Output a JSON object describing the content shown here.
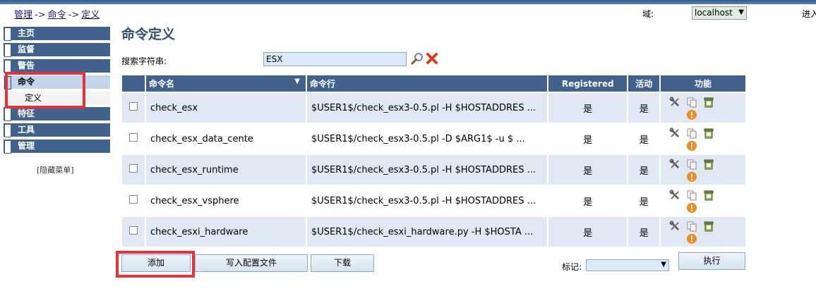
{
  "breadcrumb": {
    "item1": "管理",
    "item2": "命令",
    "item3": "定义",
    "sep": "->"
  },
  "domain": {
    "label": "域:",
    "value": "localhost"
  },
  "enter_label": "进入",
  "sidebar": {
    "items": [
      {
        "label": "主页"
      },
      {
        "label": "监督"
      },
      {
        "label": "警告"
      },
      {
        "label": "命令"
      },
      {
        "label": "特征"
      },
      {
        "label": "工具"
      },
      {
        "label": "管理"
      }
    ],
    "active_index": 3,
    "sub_label": "定义",
    "hide_menu": "[隐藏菜单]"
  },
  "main": {
    "title": "命令定义",
    "search_label": "搜索字符串:",
    "search_value": "ESX"
  },
  "table": {
    "headers": {
      "name": "命令名",
      "cmdline": "命令行",
      "registered": "Registered",
      "active": "活动",
      "func": "功能"
    },
    "rows": [
      {
        "name": "check_esx",
        "cmdline": "$USER1$/check_esx3-0.5.pl -H $HOSTADDRES ...",
        "registered": "是",
        "active": "是"
      },
      {
        "name": "check_esx_data_cente",
        "cmdline": "$USER1$/check_esx3-0.5.pl -D $ARG1$ -u $ ...",
        "registered": "是",
        "active": "是"
      },
      {
        "name": "check_esx_runtime",
        "cmdline": "$USER1$/check_esx3-0.5.pl -H $HOSTADDRES ...",
        "registered": "是",
        "active": "是"
      },
      {
        "name": "check_esx_vsphere",
        "cmdline": "$USER1$/check_esx3-0.5.pl -H $HOSTADDRES ...",
        "registered": "是",
        "active": "是"
      },
      {
        "name": "check_esxi_hardware",
        "cmdline": "$USER1$/check_esxi_hardware.py -H $HOSTA ...",
        "registered": "是",
        "active": "是"
      }
    ]
  },
  "buttons": {
    "add": "添加",
    "write_config": "写入配置文件",
    "download": "下载",
    "execute": "执行"
  },
  "mark_label": "标记:",
  "colors": {
    "header": "#40628c",
    "row_alt": "#dfe8f3",
    "title": "#2f4f74",
    "highlight": "#e8323a"
  },
  "icons": {
    "search": "magnifier-icon",
    "clear": "red-x-icon",
    "edit": "tools-icon",
    "copy": "copy-icon",
    "delete": "trash-icon",
    "info": "info-icon"
  }
}
